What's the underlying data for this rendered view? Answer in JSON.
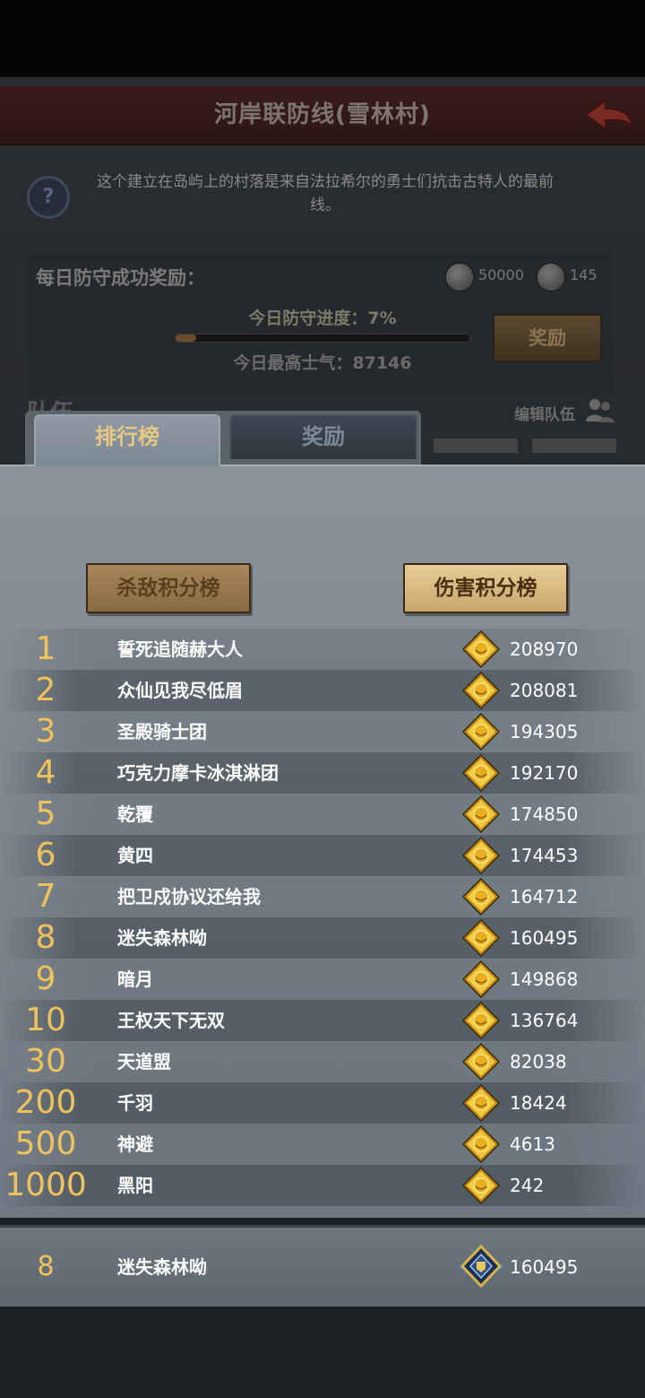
{
  "location": {
    "title": "河岸联防线(雪林村)",
    "description_line1": "这个建立在岛屿上的村落是来自法拉希尔的勇士们抗击古特人的最前",
    "description_line2": "线。"
  },
  "daily_reward": {
    "label": "每日防守成功奖励：",
    "resource1_value": "50000",
    "resource2_value": "145",
    "progress_label": "今日防守进度：7%",
    "progress_percent": 7,
    "morale_label": "今日最高士气：87146",
    "reward_button": "奖励"
  },
  "team": {
    "label": "队伍",
    "edit_label": "编辑队伍"
  },
  "tabs": {
    "ranking": "排行榜",
    "rewards": "奖励"
  },
  "leaderboards": {
    "kill_score": "杀敌积分榜",
    "damage_score": "伤害积分榜"
  },
  "rows": [
    {
      "rank": "1",
      "name": "誓死追随赫大人",
      "score": "208970"
    },
    {
      "rank": "2",
      "name": "众仙见我尽低眉",
      "score": "208081"
    },
    {
      "rank": "3",
      "name": "圣殿骑士团",
      "score": "194305"
    },
    {
      "rank": "4",
      "name": "巧克力摩卡冰淇淋团",
      "score": "192170"
    },
    {
      "rank": "5",
      "name": "乾覆",
      "score": "174850"
    },
    {
      "rank": "6",
      "name": "黄四",
      "score": "174453"
    },
    {
      "rank": "7",
      "name": "把卫戍协议还给我",
      "score": "164712"
    },
    {
      "rank": "8",
      "name": "迷失森林呦",
      "score": "160495"
    },
    {
      "rank": "9",
      "name": "暗月",
      "score": "149868"
    },
    {
      "rank": "10",
      "name": "王权天下无双",
      "score": "136764"
    },
    {
      "rank": "30",
      "name": "天道盟",
      "score": "82038"
    },
    {
      "rank": "200",
      "name": "千羽",
      "score": "18424"
    },
    {
      "rank": "500",
      "name": "神避",
      "score": "4613"
    },
    {
      "rank": "1000",
      "name": "黑阳",
      "score": "242"
    }
  ],
  "my_entry": {
    "rank": "8",
    "name": "迷失森林呦",
    "score": "160495"
  },
  "colors": {
    "rank_gold": "#f0c25a",
    "medal_gold": "#e8b928",
    "active_tab_text": "#e8c982"
  }
}
